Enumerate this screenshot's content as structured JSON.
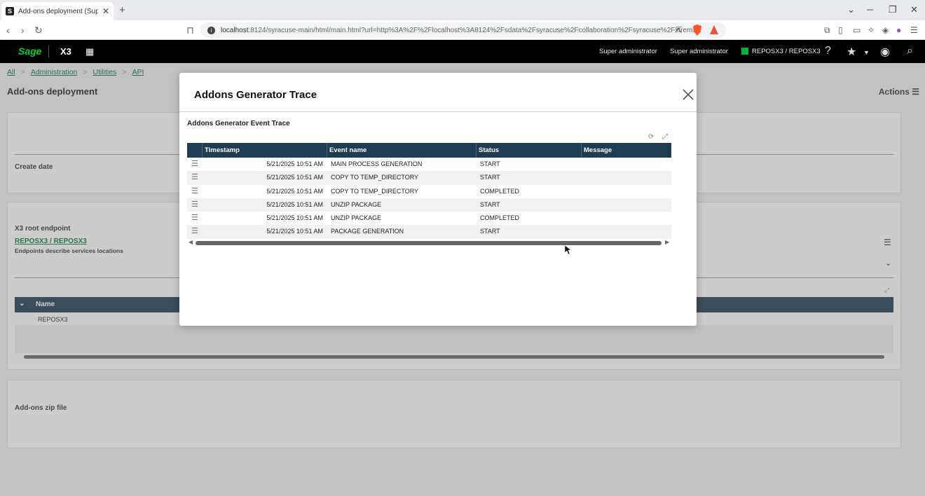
{
  "browser": {
    "tab_title": "Add-ons deployment (Super admi",
    "url_host": "localhost",
    "url_rest": ":8124/syracuse-main/html/main.html?url=http%3A%2F%2Flocalhost%3A8124%2Fsdata%2Fsyracuse%2Fcollaboration%2Fsyracuse%2Fxtrem..."
  },
  "app": {
    "logo": "Sage",
    "product": "X3",
    "user1": "Super administrator",
    "user2": "Super administrator",
    "endpoint": "REPOSX3 / REPOSX3"
  },
  "page": {
    "breadcrumbs": [
      "All",
      "Administration",
      "Utilities",
      "API"
    ],
    "title": "Add-ons deployment",
    "actions": "Actions",
    "create_date_label": "Create date",
    "root_endpoint_label": "X3 root endpoint",
    "root_endpoint_value": "REPOSX3 / REPOSX3",
    "root_endpoint_help": "Endpoints describe services locations",
    "grid_name_col": "Name",
    "grid_row1": "REPOSX3",
    "zip_label": "Add-ons zip file"
  },
  "modal": {
    "title": "Addons Generator Trace",
    "subtitle": "Addons Generator Event Trace",
    "columns": [
      "Timestamp",
      "Event name",
      "Status",
      "Message"
    ],
    "rows": [
      {
        "timestamp": "5/21/2025 10:51 AM",
        "event": "MAIN PROCESS GENERATION",
        "status": "START",
        "message": ""
      },
      {
        "timestamp": "5/21/2025 10:51 AM",
        "event": "COPY TO TEMP_DIRECTORY",
        "status": "START",
        "message": ""
      },
      {
        "timestamp": "5/21/2025 10:51 AM",
        "event": "COPY TO TEMP_DIRECTORY",
        "status": "COMPLETED",
        "message": ""
      },
      {
        "timestamp": "5/21/2025 10:51 AM",
        "event": "UNZIP PACKAGE",
        "status": "START",
        "message": ""
      },
      {
        "timestamp": "5/21/2025 10:51 AM",
        "event": "UNZIP PACKAGE",
        "status": "COMPLETED",
        "message": ""
      },
      {
        "timestamp": "5/21/2025 10:51 AM",
        "event": "PACKAGE GENERATION",
        "status": "START",
        "message": ""
      }
    ]
  },
  "colors": {
    "grid_header": "#1f3d52",
    "brand_green": "#00d639",
    "link_green": "#0a6b50"
  }
}
